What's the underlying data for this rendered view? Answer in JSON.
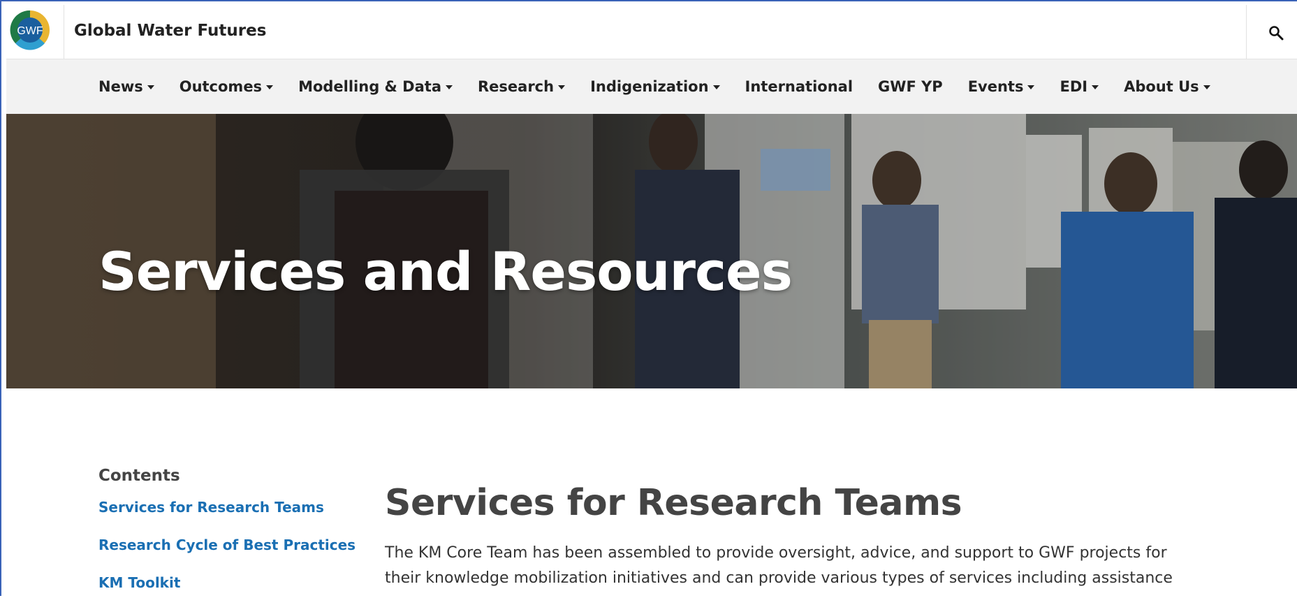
{
  "site": {
    "name": "Global Water Futures",
    "logo_text": "GWF"
  },
  "icons": {
    "search": "search-icon",
    "logo": "gwf-logo"
  },
  "nav": {
    "items": [
      {
        "label": "News",
        "dropdown": true
      },
      {
        "label": "Outcomes",
        "dropdown": true
      },
      {
        "label": "Modelling & Data",
        "dropdown": true
      },
      {
        "label": "Research",
        "dropdown": true
      },
      {
        "label": "Indigenization",
        "dropdown": true
      },
      {
        "label": "International",
        "dropdown": false
      },
      {
        "label": "GWF YP",
        "dropdown": false
      },
      {
        "label": "Events",
        "dropdown": true
      },
      {
        "label": "EDI",
        "dropdown": true
      },
      {
        "label": "About Us",
        "dropdown": true
      }
    ]
  },
  "hero": {
    "title": "Services and Resources"
  },
  "toc": {
    "heading": "Contents",
    "links": [
      "Services for Research Teams",
      "Research Cycle of Best Practices",
      "KM Toolkit"
    ]
  },
  "main": {
    "heading": "Services for Research Teams",
    "paragraph": "The KM Core Team has been assembled to provide oversight, advice, and support to GWF projects for their knowledge mobilization initiatives and can provide various types of services including assistance"
  },
  "colors": {
    "link": "#1a6fb3",
    "nav_bg": "#f2f2f2",
    "accent_border": "#3a63b8"
  }
}
